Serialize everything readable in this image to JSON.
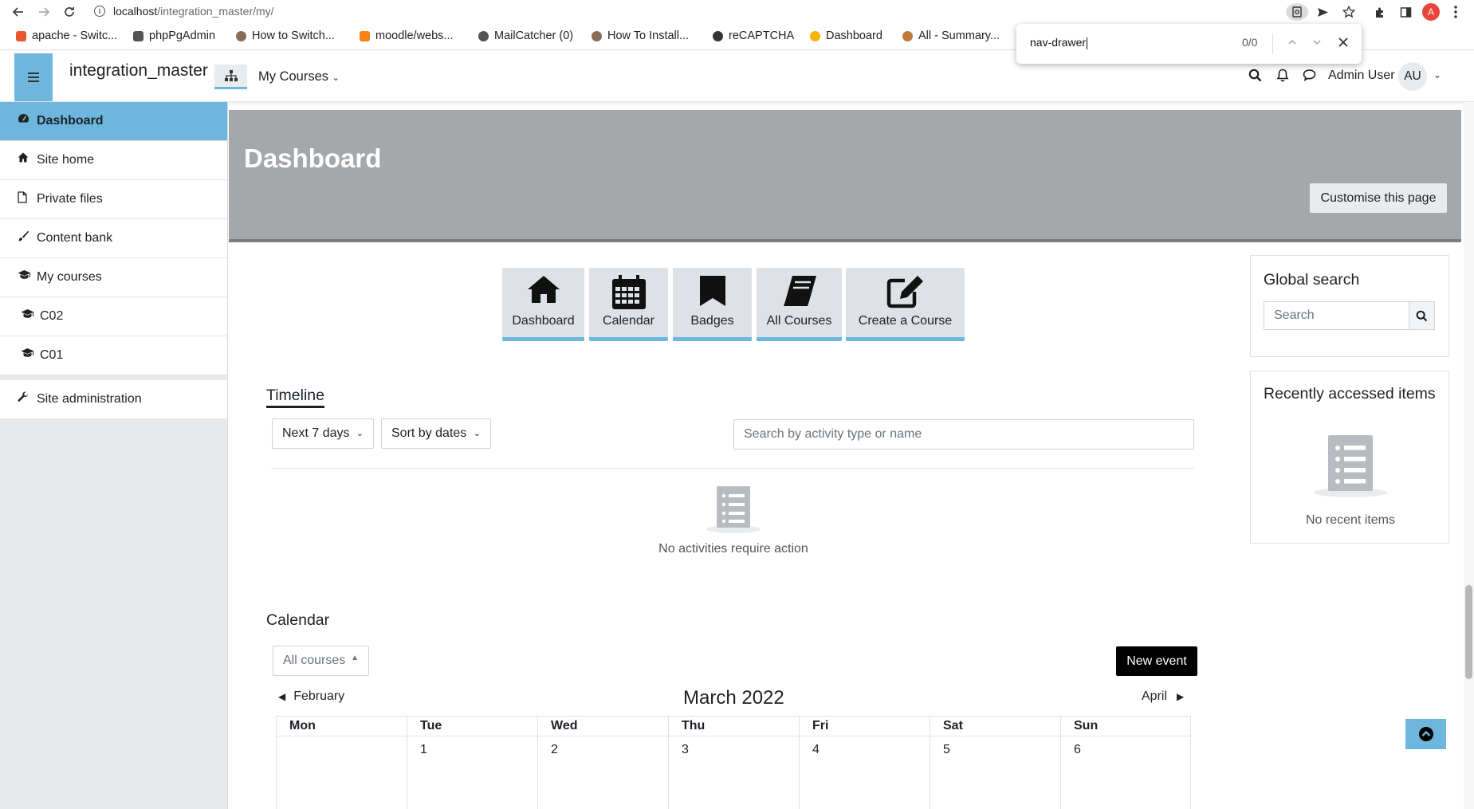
{
  "browser": {
    "url_host": "localhost",
    "url_path": "/integration_master/my/",
    "profile_initial": "A",
    "bookmarks": [
      {
        "label": "apache - Switc...",
        "color": "#e8572b"
      },
      {
        "label": "phpPgAdmin",
        "color": "#555555"
      },
      {
        "label": "How to Switch...",
        "color": "#8a6d55"
      },
      {
        "label": "moodle/webs...",
        "color": "#f98012"
      },
      {
        "label": "MailCatcher (0)",
        "color": "#555555"
      },
      {
        "label": "How To Install...",
        "color": "#8a6d55"
      },
      {
        "label": "reCAPTCHA",
        "color": "#333333"
      },
      {
        "label": "Dashboard",
        "color": "#f4b400"
      },
      {
        "label": "All - Summary...",
        "color": "#c07a3c"
      }
    ],
    "find": {
      "query": "nav-drawer",
      "count": "0/0"
    }
  },
  "navbar": {
    "site_name": "integration_master",
    "mycourses_label": "My Courses",
    "user_name": "Admin User",
    "user_initials": "AU"
  },
  "sidebar": {
    "items": [
      {
        "label": "Dashboard",
        "icon": "dashboard-icon"
      },
      {
        "label": "Site home",
        "icon": "home-icon"
      },
      {
        "label": "Private files",
        "icon": "file-icon"
      },
      {
        "label": "Content bank",
        "icon": "brush-icon"
      },
      {
        "label": "My courses",
        "icon": "graduation-cap-icon"
      },
      {
        "label": "C02",
        "icon": "graduation-cap-icon"
      },
      {
        "label": "C01",
        "icon": "graduation-cap-icon"
      }
    ],
    "admin_label": "Site administration"
  },
  "header": {
    "title": "Dashboard",
    "customise_label": "Customise this page"
  },
  "tiles": [
    {
      "label": "Dashboard",
      "icon": "home-icon"
    },
    {
      "label": "Calendar",
      "icon": "calendar-icon"
    },
    {
      "label": "Badges",
      "icon": "bookmark-icon"
    },
    {
      "label": "All Courses",
      "icon": "book-icon"
    },
    {
      "label": "Create a Course",
      "icon": "edit-icon"
    }
  ],
  "timeline": {
    "title": "Timeline",
    "range_filter": "Next 7 days",
    "sort_filter": "Sort by dates",
    "search_placeholder": "Search by activity type or name",
    "empty_text": "No activities require action"
  },
  "calendar": {
    "title": "Calendar",
    "course_filter": "All courses",
    "new_event_label": "New event",
    "prev_month": "February",
    "month": "March 2022",
    "next_month": "April",
    "days": [
      "Mon",
      "Tue",
      "Wed",
      "Thu",
      "Fri",
      "Sat",
      "Sun"
    ],
    "first_week": [
      "",
      "1",
      "2",
      "3",
      "4",
      "5",
      "6"
    ]
  },
  "global_search": {
    "title": "Global search",
    "placeholder": "Search"
  },
  "recent": {
    "title": "Recently accessed items",
    "empty_text": "No recent items"
  },
  "colors": {
    "accent": "#6db6dd",
    "header_bg": "#a5a8ab",
    "sidebar_bg": "#e7e9eb"
  }
}
